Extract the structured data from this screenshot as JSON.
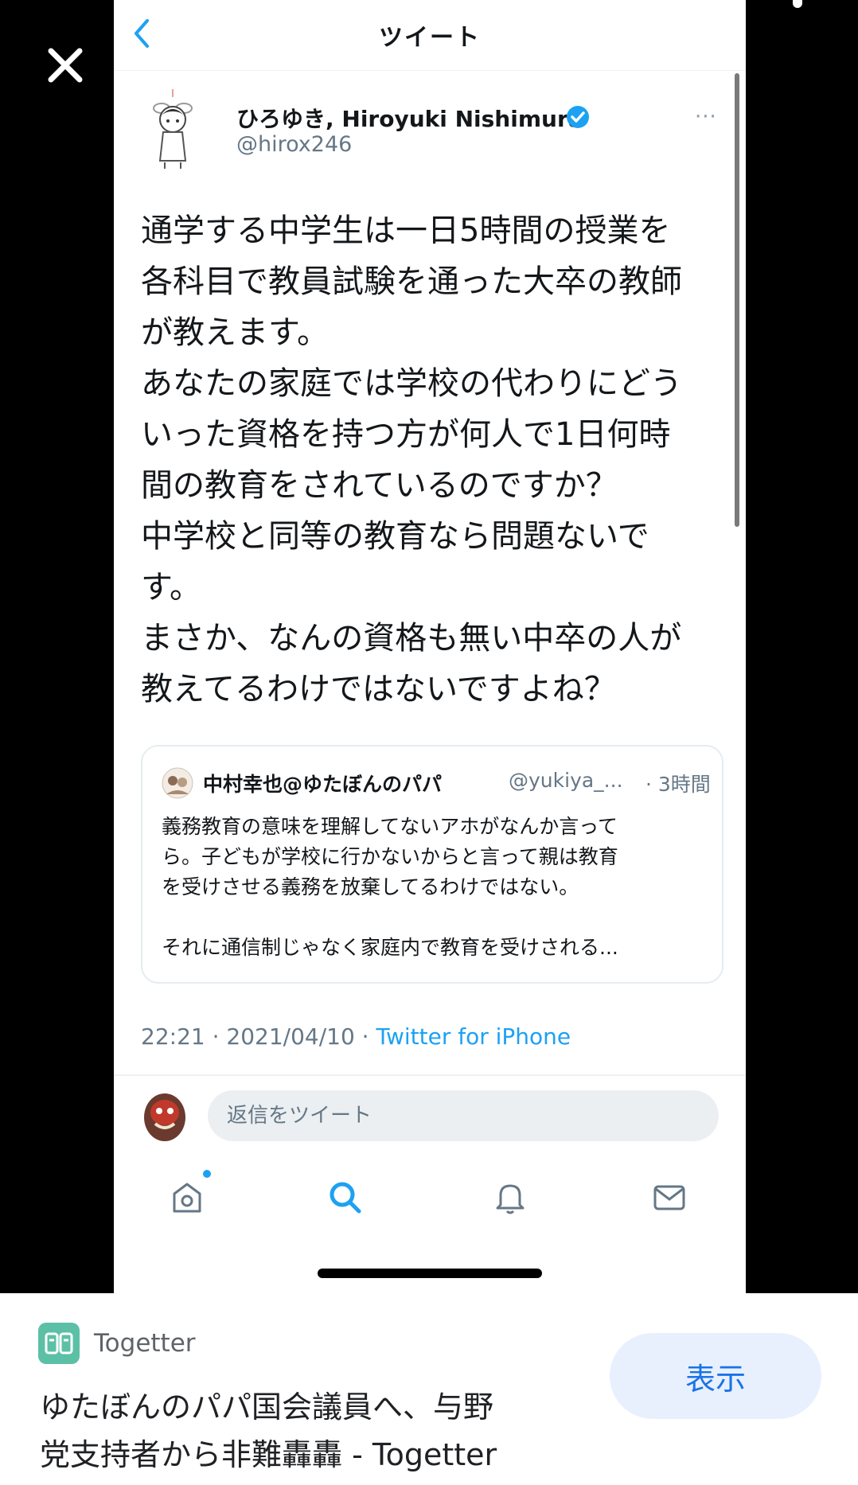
{
  "tweet_screen": {
    "title": "ツイート",
    "author": {
      "name": "ひろゆき, Hiroyuki Nishimura",
      "handle": "@hirox246"
    },
    "more_label": "···",
    "body_lines": [
      "通学する中学生は一日5時間の授業を",
      "各科目で教員試験を通った大卒の教師",
      "が教えます。",
      "あなたの家庭では学校の代わりにどう",
      "いった資格を持つ方が何人で1日何時",
      "間の教育をされているのですか？",
      "中学校と同等の教育なら問題ないで",
      "す。",
      "まさか、なんの資格も無い中卒の人が",
      "教えてるわけではないですよね？"
    ],
    "quoted_tweet": {
      "name": "中村幸也@ゆたぼんのパパ",
      "handle": "@yukiya_...",
      "time": "· 3時間",
      "lines": [
        "義務教育の意味を理解してないアホがなんか言って",
        "ら。子どもが学校に行かないからと言って親は教育",
        "を受けさせる義務を放棄してるわけではない。",
        "それに通信制じゃなく家庭内で教育を受けされる..."
      ]
    },
    "meta": {
      "datetime": "22:21 · 2021/04/10 · ",
      "source": "Twitter for iPhone"
    },
    "reply_placeholder": "返信をツイート",
    "tabs": [
      "home",
      "search",
      "notifications",
      "messages"
    ]
  },
  "banner": {
    "site_name": "Togetter",
    "title_line1": "ゆたぼんのパパ国会議員へ、与野",
    "title_line2": "党支持者から非難轟轟 - Togetter",
    "button_label": "表示"
  },
  "colors": {
    "twitter_blue": "#1da1f2",
    "togetter_green": "#5cc0a6",
    "google_blue": "#1a73e8"
  }
}
